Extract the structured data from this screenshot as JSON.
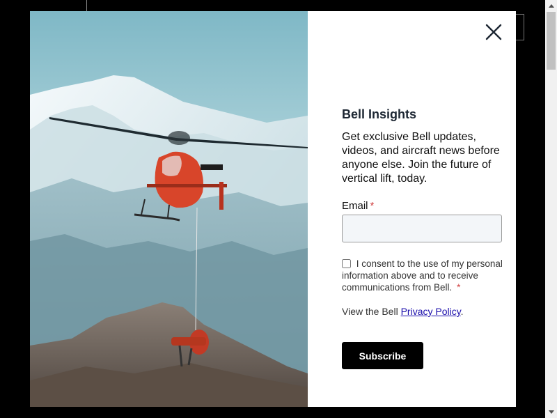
{
  "modal": {
    "title": "Bell Insights",
    "description": "Get exclusive Bell updates, videos, and aircraft news before anyone else. Join the future of vertical lift, today.",
    "email_label": "Email",
    "required_mark": "*",
    "email_value": "",
    "email_placeholder": "",
    "consent_text": "I consent to the use of my personal information above and to receive communications from Bell.",
    "privacy_prefix": "View the Bell ",
    "privacy_link": "Privacy Policy",
    "privacy_suffix": ".",
    "subscribe_label": "Subscribe",
    "hero_alt": "helicopter"
  },
  "icons": {
    "close": "close-icon"
  },
  "colors": {
    "button_bg": "#000000",
    "required": "#d14343",
    "link": "#1a0dab",
    "title": "#1d2733"
  }
}
